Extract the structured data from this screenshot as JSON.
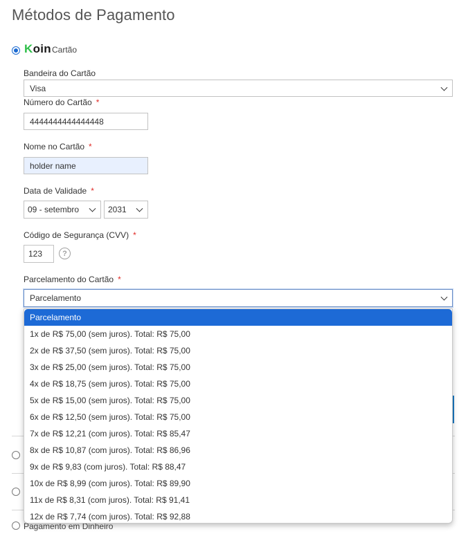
{
  "page": {
    "title": "Métodos de Pagamento"
  },
  "method": {
    "logo_text": "Koin",
    "subtitle": "Cartão"
  },
  "form": {
    "brand": {
      "label": "Bandeira do Cartão",
      "value": "Visa"
    },
    "number": {
      "label": "Número do Cartão",
      "required": "*",
      "value": "4444444444444448"
    },
    "holder": {
      "label": "Nome no Cartão",
      "required": "*",
      "value": "holder name"
    },
    "expiry": {
      "label": "Data de Validade",
      "required": "*",
      "month": "09 - setembro",
      "year": "2031"
    },
    "cvv": {
      "label": "Código de Segurança (CVV)",
      "required": "*",
      "value": "123",
      "help_icon": "?"
    },
    "installments": {
      "label": "Parcelamento do Cartão",
      "required": "*",
      "value": "Parcelamento",
      "options": [
        "Parcelamento",
        "1x de R$ 75,00 (sem juros). Total: R$ 75,00",
        "2x de R$ 37,50 (sem juros). Total: R$ 75,00",
        "3x de R$ 25,00 (sem juros). Total: R$ 75,00",
        "4x de R$ 18,75 (sem juros). Total: R$ 75,00",
        "5x de R$ 15,00 (sem juros). Total: R$ 75,00",
        "6x de R$ 12,50 (sem juros). Total: R$ 75,00",
        "7x de R$ 12,21 (com juros). Total: R$ 85,47",
        "8x de R$ 10,87 (com juros). Total: R$ 86,96",
        "9x de R$ 9,83 (com juros). Total: R$ 88,47",
        "10x de R$ 8,99 (com juros). Total: R$ 89,90",
        "11x de R$ 8,31 (com juros). Total: R$ 91,41",
        "12x de R$ 7,74 (com juros). Total: R$ 92,88"
      ]
    }
  },
  "other_methods": {
    "last_label": "Pagamento em Dinheiro"
  },
  "colors": {
    "accent": "#1d6ad6",
    "required": "#e02b27",
    "koin_green": "#2fbf4a",
    "autofill_bg": "#e8f0fe"
  }
}
